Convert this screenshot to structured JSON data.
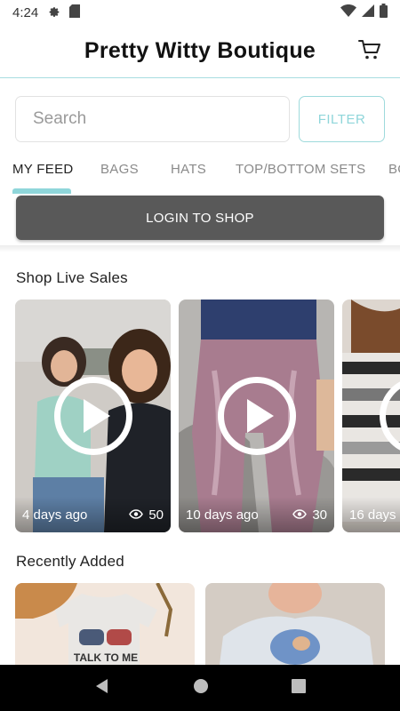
{
  "status_bar": {
    "time": "4:24"
  },
  "header": {
    "title": "Pretty Witty Boutique"
  },
  "search": {
    "placeholder": "Search",
    "value": ""
  },
  "filter_label": "FILTER",
  "tabs": [
    {
      "label": "MY FEED",
      "active": true
    },
    {
      "label": "BAGS",
      "active": false
    },
    {
      "label": "HATS",
      "active": false
    },
    {
      "label": "TOP/BOTTOM SETS",
      "active": false
    },
    {
      "label": "BO",
      "active": false
    }
  ],
  "login_label": "LOGIN TO SHOP",
  "live_sales": {
    "title": "Shop Live Sales",
    "items": [
      {
        "age": "4 days ago",
        "views": "50"
      },
      {
        "age": "10 days ago",
        "views": "30"
      },
      {
        "age": "16 days",
        "views": ""
      }
    ]
  },
  "recent": {
    "title": "Recently Added",
    "shirt_text": "TALK TO ME"
  },
  "colors": {
    "accent": "#8fd6da",
    "login_bg": "#595959",
    "header_border": "#a8dde0"
  }
}
